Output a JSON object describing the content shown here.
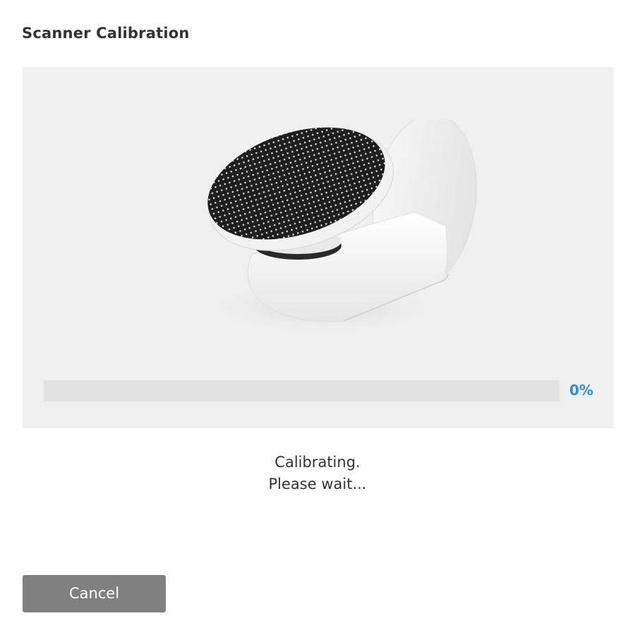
{
  "dialog": {
    "title": "Scanner Calibration"
  },
  "illustration": {
    "icon": "scanner-calibration-target-icon"
  },
  "progress": {
    "value": 0,
    "label": "0%",
    "accent_color": "#2b8fe0"
  },
  "status": {
    "line1": "Calibrating.",
    "line2": "Please wait..."
  },
  "actions": {
    "cancel_label": "Cancel"
  }
}
